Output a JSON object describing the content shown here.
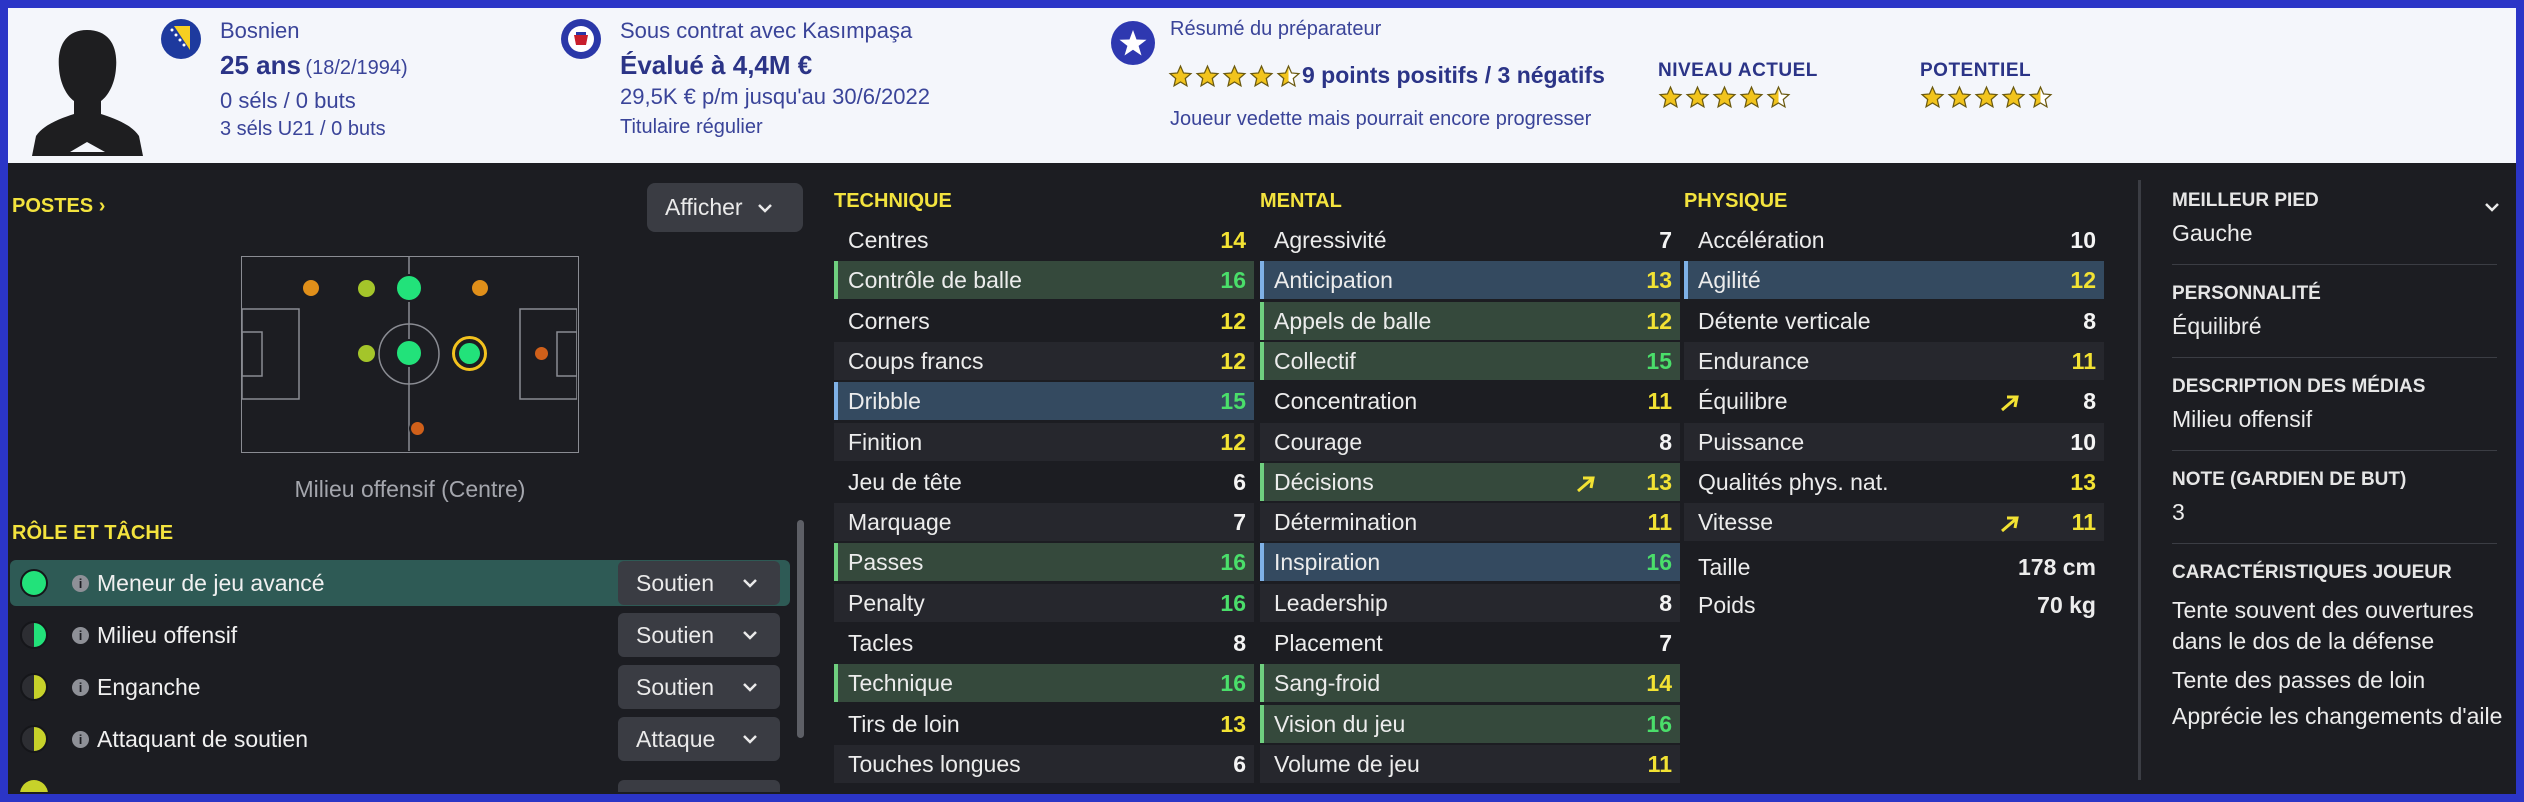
{
  "header": {
    "nationality": "Bosnien",
    "age": "25 ans",
    "dob": "(18/2/1994)",
    "caps": "0 séls / 0 buts",
    "u21_caps": "3 séls U21 / 0 buts",
    "contract": "Sous contrat avec Kasımpaşa",
    "value": "Évalué à 4,4M €",
    "wage": "29,5K € p/m jusqu'au 30/6/2022",
    "status": "Titulaire régulier",
    "coach_summary_title": "Résumé du préparateur",
    "points": "9 points positifs / 3 négatifs",
    "coach_comment": "Joueur vedette mais pourrait encore progresser",
    "current_ability_label": "NIVEAU ACTUEL",
    "potential_label": "POTENTIEL",
    "summary_stars": 4.5,
    "current_ability_stars": 4.5,
    "potential_stars": 4.5
  },
  "positions": {
    "title": "POSTES",
    "show_button": "Afficher",
    "position_name": "Milieu offensif (Centre)"
  },
  "roles": {
    "title": "RÔLE ET TÂCHE",
    "items": [
      {
        "name": "Meneur de jeu avancé",
        "duty": "Soutien"
      },
      {
        "name": "Milieu offensif",
        "duty": "Soutien"
      },
      {
        "name": "Enganche",
        "duty": "Soutien"
      },
      {
        "name": "Attaquant de soutien",
        "duty": "Attaque"
      }
    ]
  },
  "technical": {
    "title": "TECHNIQUE",
    "items": [
      {
        "name": "Centres",
        "value": "14"
      },
      {
        "name": "Contrôle de balle",
        "value": "16"
      },
      {
        "name": "Corners",
        "value": "12"
      },
      {
        "name": "Coups francs",
        "value": "12"
      },
      {
        "name": "Dribble",
        "value": "15"
      },
      {
        "name": "Finition",
        "value": "12"
      },
      {
        "name": "Jeu de tête",
        "value": "6"
      },
      {
        "name": "Marquage",
        "value": "7"
      },
      {
        "name": "Passes",
        "value": "16"
      },
      {
        "name": "Penalty",
        "value": "16"
      },
      {
        "name": "Tacles",
        "value": "8"
      },
      {
        "name": "Technique",
        "value": "16"
      },
      {
        "name": "Tirs de loin",
        "value": "13"
      },
      {
        "name": "Touches longues",
        "value": "6"
      }
    ]
  },
  "mental": {
    "title": "MENTAL",
    "items": [
      {
        "name": "Agressivité",
        "value": "7"
      },
      {
        "name": "Anticipation",
        "value": "13"
      },
      {
        "name": "Appels de balle",
        "value": "12"
      },
      {
        "name": "Collectif",
        "value": "15"
      },
      {
        "name": "Concentration",
        "value": "11"
      },
      {
        "name": "Courage",
        "value": "8"
      },
      {
        "name": "Décisions",
        "value": "13"
      },
      {
        "name": "Détermination",
        "value": "11"
      },
      {
        "name": "Inspiration",
        "value": "16"
      },
      {
        "name": "Leadership",
        "value": "8"
      },
      {
        "name": "Placement",
        "value": "7"
      },
      {
        "name": "Sang-froid",
        "value": "14"
      },
      {
        "name": "Vision du jeu",
        "value": "16"
      },
      {
        "name": "Volume de jeu",
        "value": "11"
      }
    ]
  },
  "physical": {
    "title": "PHYSIQUE",
    "items": [
      {
        "name": "Accélération",
        "value": "10"
      },
      {
        "name": "Agilité",
        "value": "12"
      },
      {
        "name": "Détente verticale",
        "value": "8"
      },
      {
        "name": "Endurance",
        "value": "11"
      },
      {
        "name": "Équilibre",
        "value": "8"
      },
      {
        "name": "Puissance",
        "value": "10"
      },
      {
        "name": "Qualités phys. nat.",
        "value": "13"
      },
      {
        "name": "Vitesse",
        "value": "11"
      }
    ],
    "height_label": "Taille",
    "height": "178 cm",
    "weight_label": "Poids",
    "weight": "70 kg"
  },
  "side": {
    "foot_label": "MEILLEUR PIED",
    "foot": "Gauche",
    "personality_label": "PERSONNALITÉ",
    "personality": "Équilibré",
    "media_label": "DESCRIPTION DES MÉDIAS",
    "media": "Milieu offensif",
    "gk_label": "NOTE (GARDIEN DE BUT)",
    "gk": "3",
    "traits_label": "CARACTÉRISTIQUES JOUEUR",
    "trait_1a": "Tente souvent des ouvertures",
    "trait_1b": "dans le dos de la défense",
    "trait_2": "Tente des passes de loin",
    "trait_3": "Apprécie les changements d'aile"
  },
  "colors": {
    "accent": "#f3e33e",
    "frame": "#2b35c7",
    "header_text": "#2b3487",
    "good": "#4ade6a",
    "medium": "#f2e233",
    "pos_natural": "#22e27a",
    "pos_good": "#a4c52a",
    "pos_poor": "#e08f1a",
    "pos_weak": "#d0601a"
  }
}
